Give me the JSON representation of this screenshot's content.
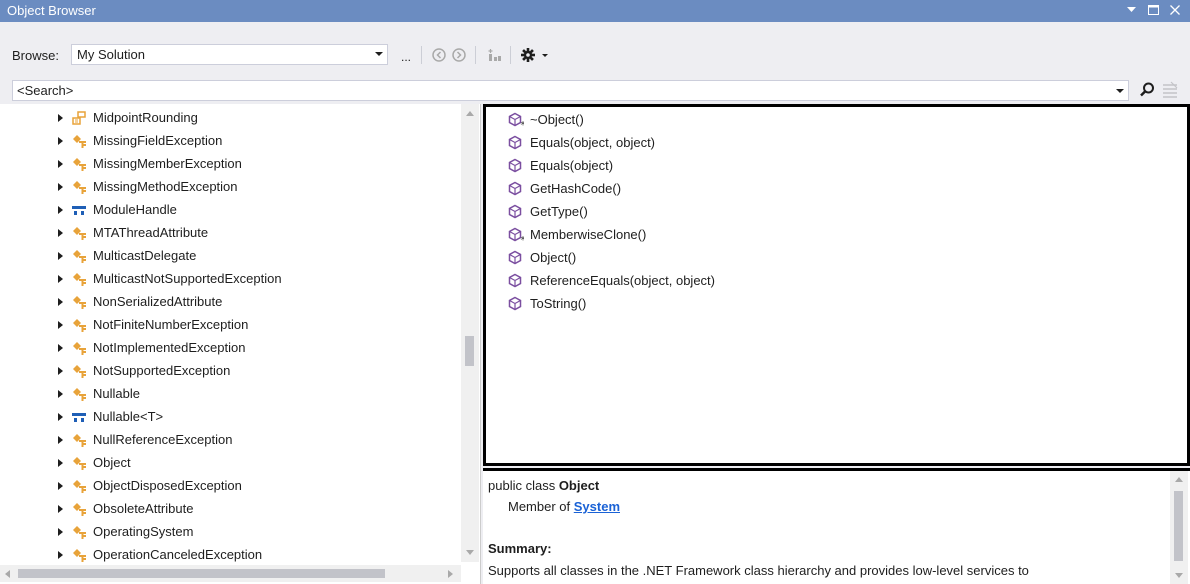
{
  "window": {
    "title": "Object Browser"
  },
  "toolbar": {
    "browse_label": "Browse:",
    "browse_value": "My Solution",
    "ellipsis_label": "..."
  },
  "search": {
    "value": "<Search>"
  },
  "tree": {
    "items": [
      {
        "label": "MidpointRounding",
        "icon": "enum-icon"
      },
      {
        "label": "MissingFieldException",
        "icon": "class-icon"
      },
      {
        "label": "MissingMemberException",
        "icon": "class-icon"
      },
      {
        "label": "MissingMethodException",
        "icon": "class-icon"
      },
      {
        "label": "ModuleHandle",
        "icon": "struct-icon"
      },
      {
        "label": "MTAThreadAttribute",
        "icon": "class-icon"
      },
      {
        "label": "MulticastDelegate",
        "icon": "class-icon"
      },
      {
        "label": "MulticastNotSupportedException",
        "icon": "class-icon"
      },
      {
        "label": "NonSerializedAttribute",
        "icon": "class-icon"
      },
      {
        "label": "NotFiniteNumberException",
        "icon": "class-icon"
      },
      {
        "label": "NotImplementedException",
        "icon": "class-icon"
      },
      {
        "label": "NotSupportedException",
        "icon": "class-icon"
      },
      {
        "label": "Nullable",
        "icon": "class-icon"
      },
      {
        "label": "Nullable<T>",
        "icon": "struct-icon"
      },
      {
        "label": "NullReferenceException",
        "icon": "class-icon"
      },
      {
        "label": "Object",
        "icon": "class-icon"
      },
      {
        "label": "ObjectDisposedException",
        "icon": "class-icon"
      },
      {
        "label": "ObsoleteAttribute",
        "icon": "class-icon"
      },
      {
        "label": "OperatingSystem",
        "icon": "class-icon"
      },
      {
        "label": "OperationCanceledException",
        "icon": "class-icon"
      }
    ]
  },
  "members": {
    "items": [
      {
        "label": "~Object()",
        "icon": "protected-method-icon"
      },
      {
        "label": "Equals(object, object)",
        "icon": "method-icon"
      },
      {
        "label": "Equals(object)",
        "icon": "method-icon"
      },
      {
        "label": "GetHashCode()",
        "icon": "method-icon"
      },
      {
        "label": "GetType()",
        "icon": "method-icon"
      },
      {
        "label": "MemberwiseClone()",
        "icon": "protected-method-icon"
      },
      {
        "label": "Object()",
        "icon": "method-icon"
      },
      {
        "label": "ReferenceEquals(object, object)",
        "icon": "method-icon"
      },
      {
        "label": "ToString()",
        "icon": "method-icon"
      }
    ]
  },
  "description": {
    "decl_prefix": "public class ",
    "decl_name": "Object",
    "member_of_prefix": "Member of ",
    "member_of_link": "System",
    "summary_heading": "Summary:",
    "summary_text": "Supports all classes in the .NET Framework class hierarchy and provides low-level services to"
  },
  "colors": {
    "titlebar": "#6b8cc1",
    "class_icon": "#e8a33a",
    "method_icon": "#7b4fa0",
    "struct_icon": "#1f5fb6",
    "link": "#1a62d6"
  }
}
